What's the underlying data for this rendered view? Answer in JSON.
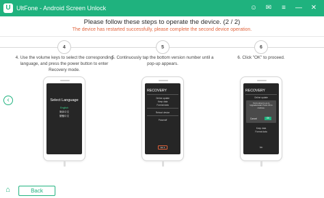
{
  "window": {
    "title": "UltFone - Android Screen Unlock",
    "logo_letter": "U",
    "controls": {
      "user": "☺",
      "feedback": "✉",
      "menu": "≡",
      "minimize": "—",
      "close": "✕"
    }
  },
  "header": {
    "title": "Please follow these steps to operate the device. (2 / 2)",
    "subtitle": "The device has restarted successfully, please complete the second device operation."
  },
  "steps": [
    {
      "number": "4",
      "text": "4. Use the volume keys to select the corresponding language, and press the power button to enter Recovery mode.",
      "screen": {
        "title": "Select Language",
        "options": [
          "English",
          "简体中文",
          "繁體中文"
        ]
      }
    },
    {
      "number": "5",
      "text": "5. Continuously tap the bottom version number until a pop-up appears.",
      "screen": {
        "title": "RECOVERY",
        "items": [
          "Online update",
          "Keep data",
          "Format data",
          "Reboot device",
          "Poweroff"
        ],
        "button": "Ver 1"
      }
    },
    {
      "number": "6",
      "text": "6. Click \"OK\" to proceed.",
      "screen": {
        "title": "RECOVERY",
        "items": [
          "Online update",
          "Keep data",
          "Format data"
        ],
        "dialog_text": "You're about to go to UpgradeInstall. Press OK to continue.",
        "cancel": "Cancel",
        "ok": "OK",
        "footer": "Ver"
      }
    }
  ],
  "nav": {
    "prev_arrow": "‹"
  },
  "footer": {
    "home_icon": "⌂",
    "back_label": "Back"
  },
  "colors": {
    "accent": "#1fb27e",
    "warning": "#e0623a",
    "screen": "#262626"
  }
}
